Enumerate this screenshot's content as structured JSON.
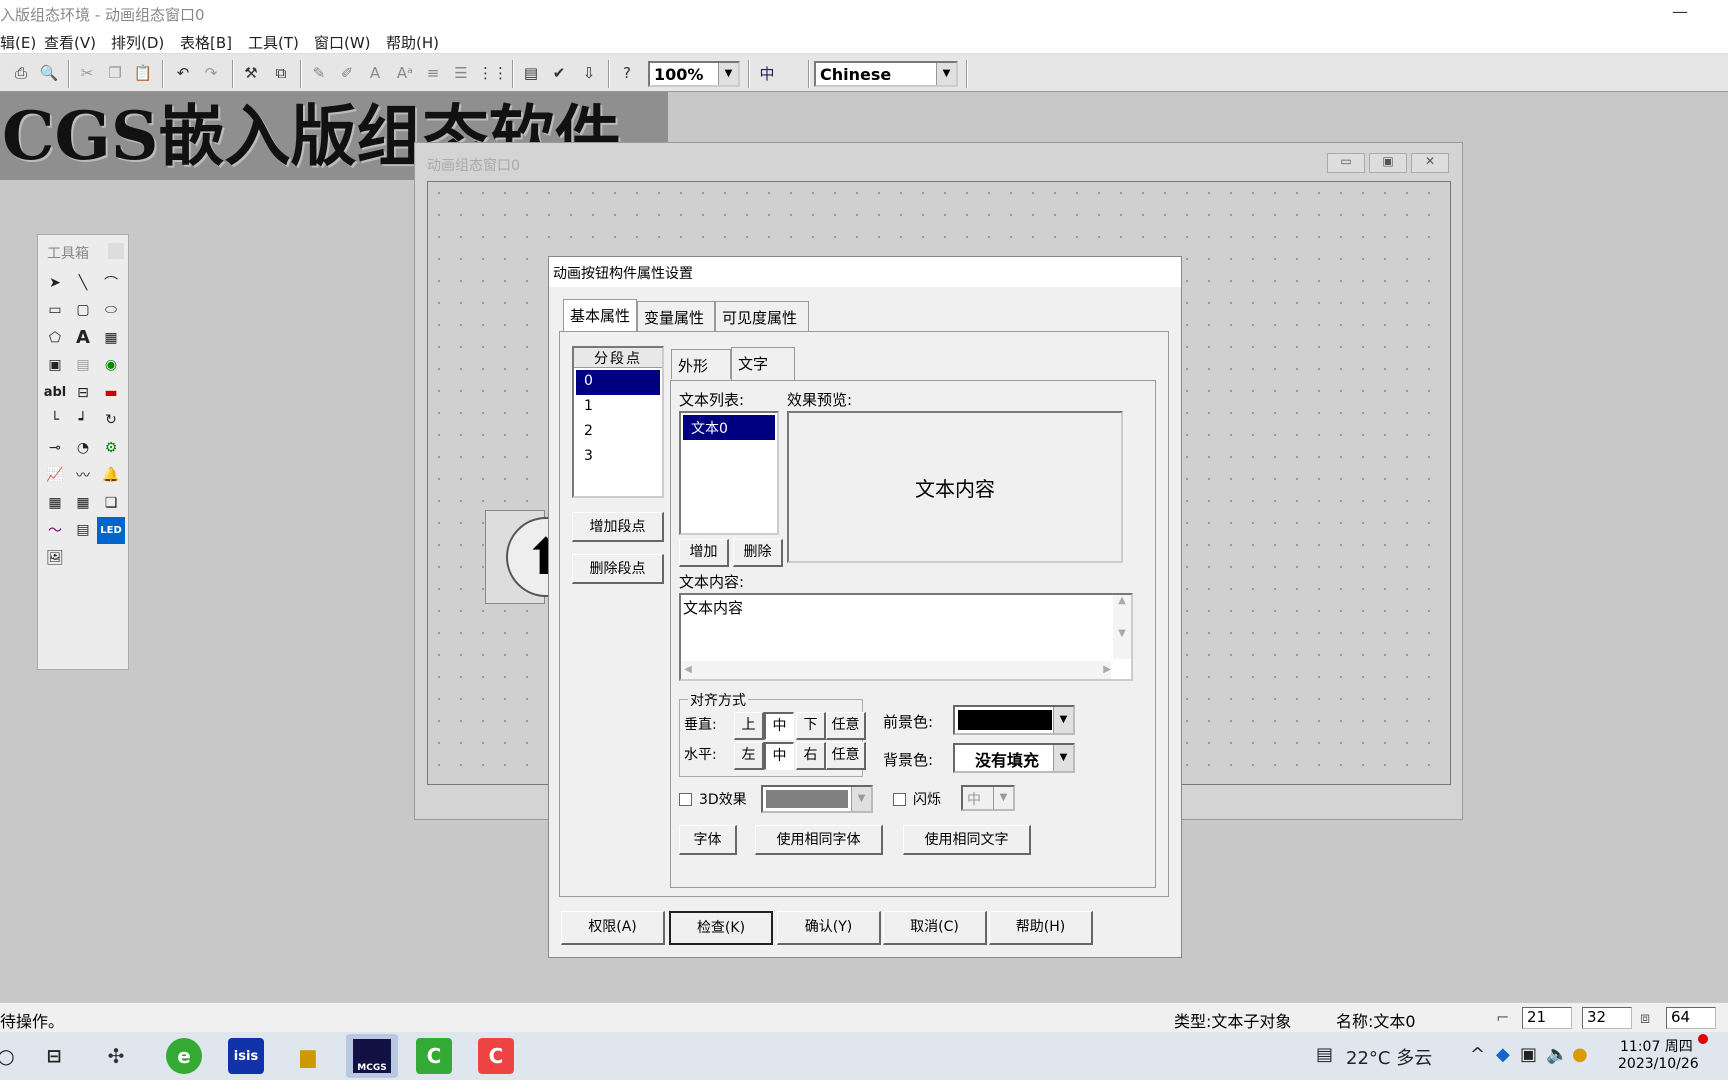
{
  "window": {
    "title": "入版组态环境 - 动画组态窗口0"
  },
  "menu": [
    {
      "label": "辑(E)"
    },
    {
      "label": "查看(V)"
    },
    {
      "label": "排列(D)"
    },
    {
      "label": "表格[B]"
    },
    {
      "label": "工具(T)"
    },
    {
      "label": "窗口(W)"
    },
    {
      "label": "帮助(H)"
    }
  ],
  "toolbar": {
    "zoom": "100%",
    "language": "Chinese"
  },
  "banner": {
    "text": "CGS嵌入版组态软件"
  },
  "toolbox": {
    "title": "工具箱"
  },
  "anim_window": {
    "title": "动画组态窗口0"
  },
  "dialog": {
    "title": "动画按钮构件属性设置",
    "tabs": [
      {
        "label": "基本属性"
      },
      {
        "label": "变量属性"
      },
      {
        "label": "可见度属性"
      }
    ],
    "segment_header": "分段点",
    "segments": [
      "0",
      "1",
      "2",
      "3"
    ],
    "add_segment": "增加段点",
    "delete_segment": "删除段点",
    "subtabs": [
      {
        "label": "外形"
      },
      {
        "label": "文字"
      }
    ],
    "text_list_label": "文本列表:",
    "text_list": [
      "文本0"
    ],
    "preview_label": "效果预览:",
    "preview_text": "文本内容",
    "add": "增加",
    "delete": "删除",
    "content_label": "文本内容:",
    "content_value": "文本内容",
    "align_group": "对齐方式",
    "vertical_label": "垂直:",
    "horizontal_label": "水平:",
    "v_options": [
      "上",
      "中",
      "下",
      "任意"
    ],
    "h_options": [
      "左",
      "中",
      "右",
      "任意"
    ],
    "fg_label": "前景色:",
    "bg_label": "背景色:",
    "bg_value": "没有填充",
    "effect3d": "3D效果",
    "blink": "闪烁",
    "blink_speed": "中",
    "font_btn": "字体",
    "same_font_btn": "使用相同字体",
    "same_text_btn": "使用相同文字",
    "buttons": {
      "perm": "权限(A)",
      "check": "检查(K)",
      "ok": "确认(Y)",
      "cancel": "取消(C)",
      "help": "帮助(H)"
    }
  },
  "status": {
    "left": "待操作。",
    "type": "类型:文本子对象",
    "name": "名称:文本0",
    "x": "21",
    "y": "32",
    "w": "64"
  },
  "taskbar": {
    "weather": "22°C 多云",
    "time": "11:07 周四",
    "date": "2023/10/26",
    "apps": [
      "isis",
      "MCGS"
    ]
  },
  "colors": {
    "selection": "#000080",
    "foreground": "#000000",
    "effect_gray": "#808080"
  }
}
